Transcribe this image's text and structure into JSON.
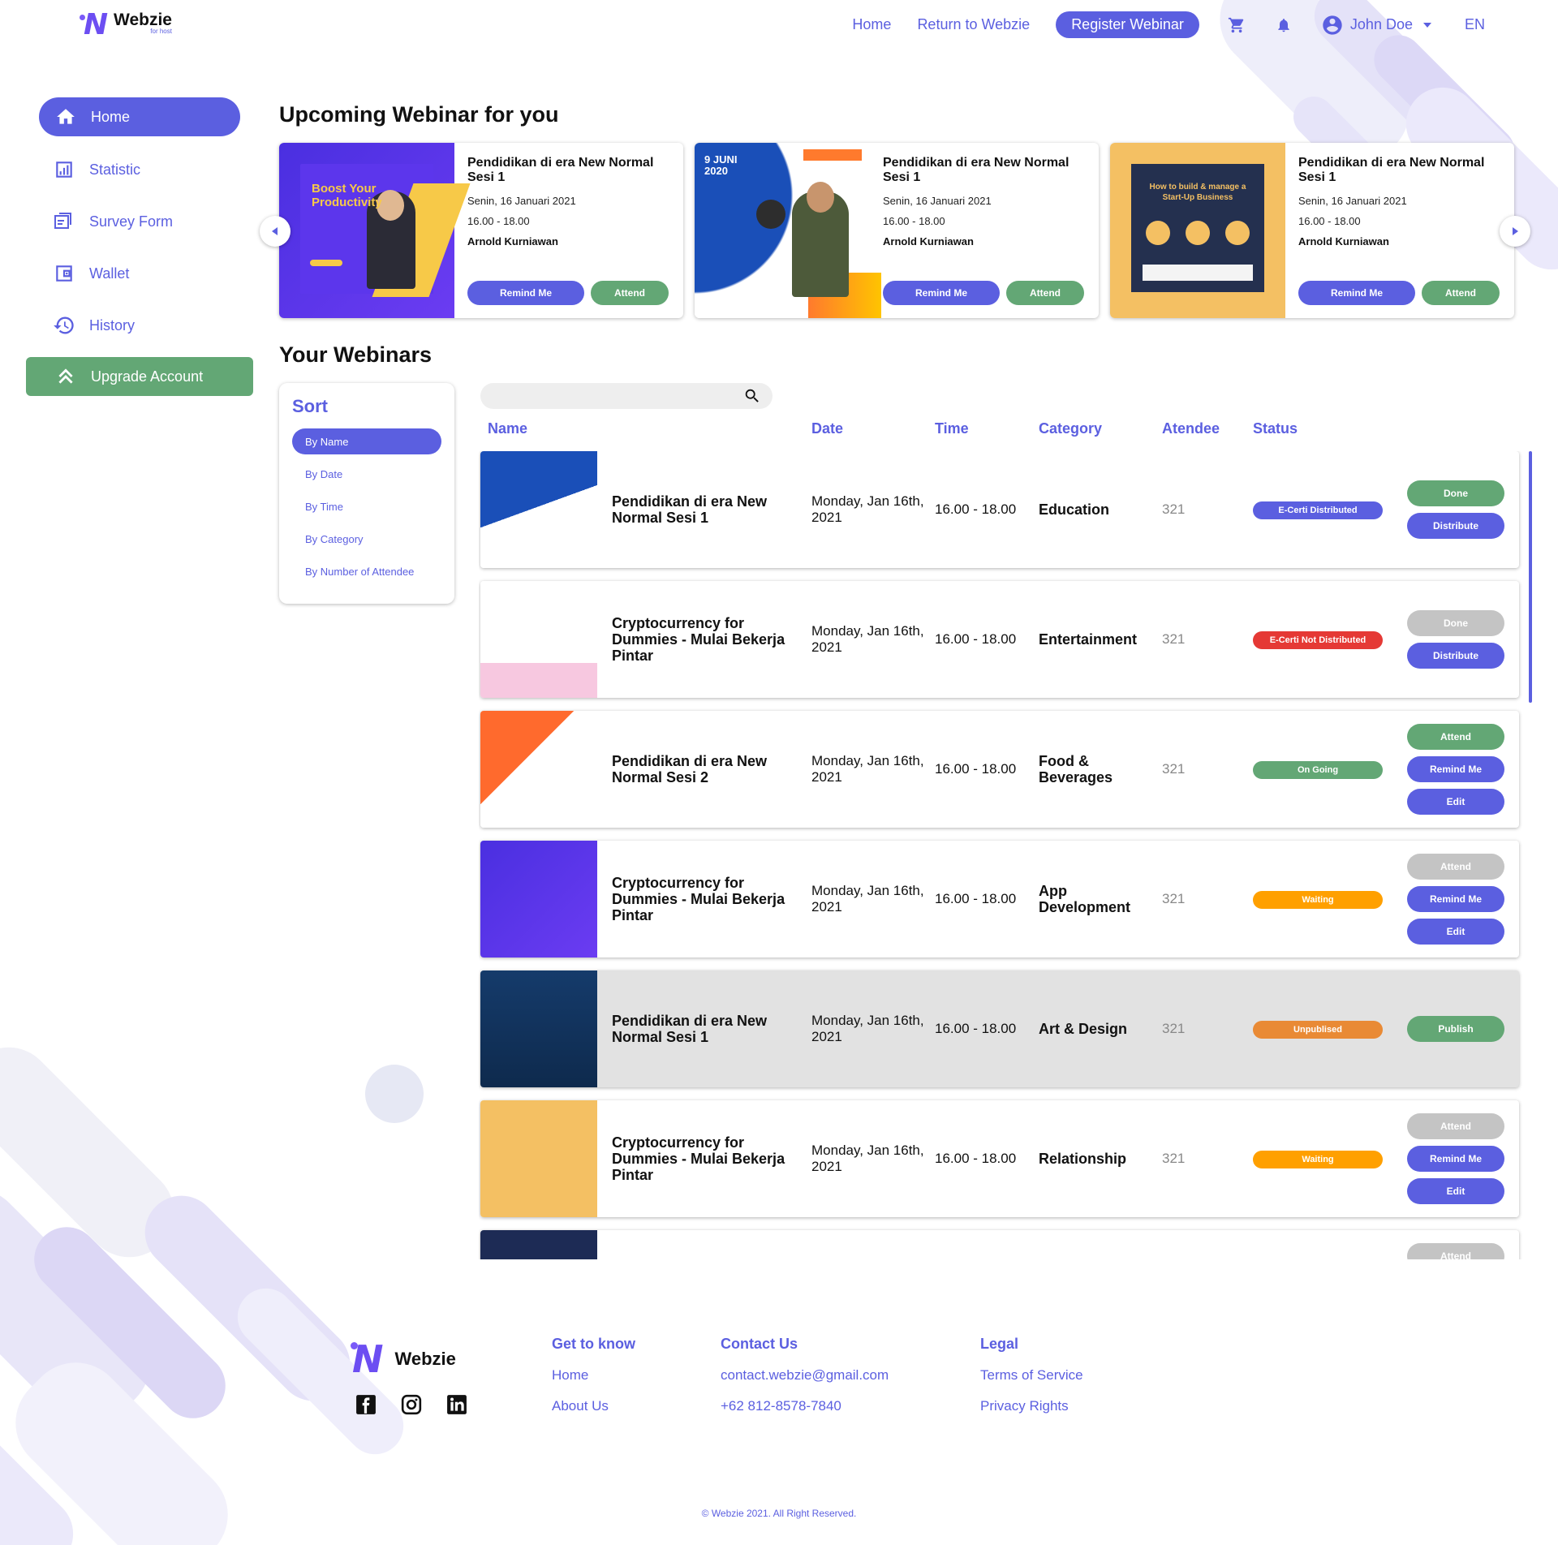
{
  "brand": {
    "name": "Webzie",
    "tagline": "for host"
  },
  "colors": {
    "primary": "#5b5fe0",
    "green": "#63a775",
    "red": "#e53935",
    "orange": "#ffa000",
    "darkorange": "#e98a35",
    "grey": "#c4c4c4"
  },
  "header": {
    "links": [
      "Home",
      "Return to Webzie"
    ],
    "register": "Register Webinar",
    "user": "John Doe",
    "lang": "EN",
    "icons": [
      "cart-icon",
      "bell-icon",
      "user-avatar-icon",
      "chevron-down-icon"
    ]
  },
  "sidebar": {
    "items": [
      {
        "label": "Home",
        "icon": "home-icon",
        "active": true
      },
      {
        "label": "Statistic",
        "icon": "chart-icon"
      },
      {
        "label": "Survey Form",
        "icon": "form-icon"
      },
      {
        "label": "Wallet",
        "icon": "wallet-icon"
      },
      {
        "label": "History",
        "icon": "history-icon"
      }
    ],
    "upgrade": "Upgrade Account"
  },
  "upcoming": {
    "title": "Upcoming Webinar for you",
    "cards": [
      {
        "title": "Pendidikan di era New Normal Sesi 1",
        "date": "Senin, 16 Januari 2021",
        "time": "16.00 - 18.00",
        "host": "Arnold Kurniawan",
        "remind": "Remind Me",
        "attend": "Attend",
        "poster_text": "Boost Your Productivity"
      },
      {
        "title": "Pendidikan di era New Normal Sesi 1",
        "date": "Senin, 16 Januari 2021",
        "time": "16.00 - 18.00",
        "host": "Arnold Kurniawan",
        "remind": "Remind Me",
        "attend": "Attend",
        "poster_text": "9 JUNI 2020"
      },
      {
        "title": "Pendidikan di era New Normal Sesi 1",
        "date": "Senin, 16 Januari 2021",
        "time": "16.00 - 18.00",
        "host": "Arnold Kurniawan",
        "remind": "Remind Me",
        "attend": "Attend",
        "poster_text": "How to build & manage a Start-Up Business"
      }
    ]
  },
  "webinars": {
    "title": "Your Webinars",
    "sort": {
      "title": "Sort",
      "options": [
        "By Name",
        "By Date",
        "By Time",
        "By Category",
        "By Number of Attendee"
      ],
      "active": 0
    },
    "search": {
      "placeholder": ""
    },
    "columns": [
      "Name",
      "Date",
      "Time",
      "Category",
      "Atendee",
      "Status"
    ],
    "rows": [
      {
        "name": "Pendidikan di era New Normal Sesi 1",
        "date": "Monday, Jan 16th, 2021",
        "time": "16.00 - 18.00",
        "category": "Education",
        "attendee": "321",
        "status": "E-Certi Distributed",
        "status_color": "#5b5fe0",
        "actions": [
          {
            "label": "Done",
            "color": "#63a775"
          },
          {
            "label": "Distribute",
            "color": "#5b5fe0"
          }
        ],
        "grey": false
      },
      {
        "name": "Cryptocurrency for Dummies - Mulai Bekerja Pintar",
        "date": "Monday, Jan 16th, 2021",
        "time": "16.00 - 18.00",
        "category": "Entertainment",
        "attendee": "321",
        "status": "E-Certi Not Distributed",
        "status_color": "#e53935",
        "actions": [
          {
            "label": "Done",
            "color": "#c4c4c4"
          },
          {
            "label": "Distribute",
            "color": "#5b5fe0"
          }
        ],
        "grey": false
      },
      {
        "name": "Pendidikan di era New Normal Sesi 2",
        "date": "Monday, Jan 16th, 2021",
        "time": "16.00 - 18.00",
        "category": "Food & Beverages",
        "attendee": "321",
        "status": "On Going",
        "status_color": "#63a775",
        "actions": [
          {
            "label": "Attend",
            "color": "#63a775"
          },
          {
            "label": "Remind Me",
            "color": "#5b5fe0"
          },
          {
            "label": "Edit",
            "color": "#5b5fe0"
          }
        ],
        "grey": false
      },
      {
        "name": "Cryptocurrency for Dummies - Mulai Bekerja Pintar",
        "date": "Monday, Jan 16th, 2021",
        "time": "16.00 - 18.00",
        "category": "App Development",
        "attendee": "321",
        "status": "Waiting",
        "status_color": "#ffa000",
        "actions": [
          {
            "label": "Attend",
            "color": "#c4c4c4"
          },
          {
            "label": "Remind Me",
            "color": "#5b5fe0"
          },
          {
            "label": "Edit",
            "color": "#5b5fe0"
          }
        ],
        "grey": false
      },
      {
        "name": "Pendidikan di era New Normal Sesi 1",
        "date": "Monday, Jan 16th, 2021",
        "time": "16.00 - 18.00",
        "category": "Art & Design",
        "attendee": "321",
        "status": "Unpublised",
        "status_color": "#e98a35",
        "actions": [
          {
            "label": "Publish",
            "color": "#63a775"
          }
        ],
        "grey": true
      },
      {
        "name": "Cryptocurrency for Dummies - Mulai Bekerja Pintar",
        "date": "Monday, Jan 16th, 2021",
        "time": "16.00 - 18.00",
        "category": "Relationship",
        "attendee": "321",
        "status": "Waiting",
        "status_color": "#ffa000",
        "actions": [
          {
            "label": "Attend",
            "color": "#c4c4c4"
          },
          {
            "label": "Remind Me",
            "color": "#5b5fe0"
          },
          {
            "label": "Edit",
            "color": "#5b5fe0"
          }
        ],
        "grey": false
      },
      {
        "name": "",
        "date": "",
        "time": "",
        "category": "",
        "attendee": "",
        "status": "",
        "status_color": "",
        "actions": [
          {
            "label": "Attend",
            "color": "#c4c4c4"
          }
        ],
        "grey": false
      }
    ]
  },
  "footer": {
    "brand": "Webzie",
    "social": [
      "facebook-icon",
      "instagram-icon",
      "linkedin-icon"
    ],
    "cols": [
      {
        "title": "Get to know",
        "links": [
          "Home",
          "About Us"
        ]
      },
      {
        "title": "Contact Us",
        "links": [
          "contact.webzie@gmail.com",
          "+62 812-8578-7840"
        ]
      },
      {
        "title": "Legal",
        "links": [
          "Terms of Service",
          "Privacy Rights"
        ]
      }
    ],
    "copyright": "© Webzie 2021. All Right Reserved."
  }
}
